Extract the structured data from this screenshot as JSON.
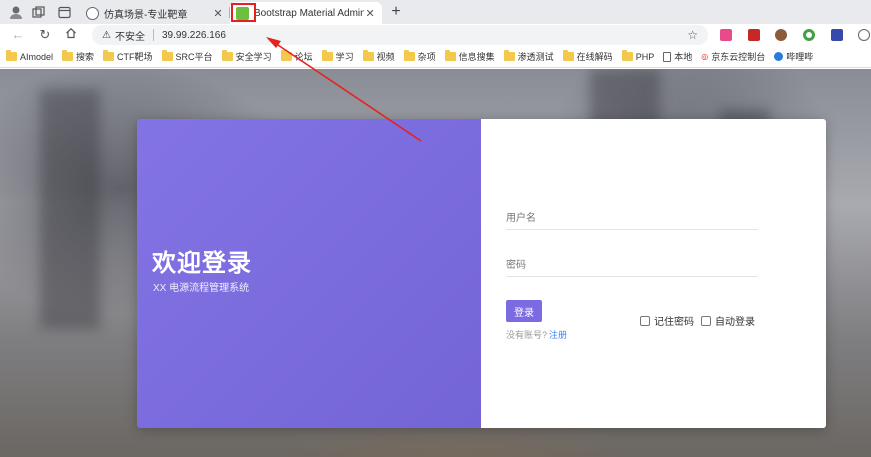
{
  "browser": {
    "tabs": [
      {
        "title": "仿真场景-专业靶章",
        "active": false,
        "favicon_color": "#555555"
      },
      {
        "title": "Bootstrap Material Admin",
        "active": true,
        "favicon_color": "#6cbf3f"
      }
    ],
    "new_tab_icon": "plus-icon",
    "address": {
      "security_label": "不安全",
      "url": "39.99.226.166"
    },
    "bookmarks": [
      {
        "label": "AImodel",
        "icon": "folder-icon"
      },
      {
        "label": "搜索",
        "icon": "folder-icon"
      },
      {
        "label": "CTF靶场",
        "icon": "folder-icon"
      },
      {
        "label": "SRC平台",
        "icon": "folder-icon"
      },
      {
        "label": "安全学习",
        "icon": "folder-icon"
      },
      {
        "label": "论坛",
        "icon": "folder-icon"
      },
      {
        "label": "学习",
        "icon": "folder-icon"
      },
      {
        "label": "视频",
        "icon": "folder-icon"
      },
      {
        "label": "杂项",
        "icon": "folder-icon"
      },
      {
        "label": "信息搜集",
        "icon": "folder-icon"
      },
      {
        "label": "渗透测试",
        "icon": "folder-icon"
      },
      {
        "label": "在线解码",
        "icon": "folder-icon"
      },
      {
        "label": "PHP",
        "icon": "folder-icon"
      },
      {
        "label": "本地",
        "icon": "page-icon"
      },
      {
        "label": "京东云控制台",
        "icon": "jd-icon"
      },
      {
        "label": "哔哩哔",
        "icon": "bilibili-icon"
      }
    ]
  },
  "login": {
    "welcome_title": "欢迎登录",
    "subtitle": "XX 电源流程管理系统",
    "username_placeholder": "用户名",
    "password_placeholder": "密码",
    "login_button": "登录",
    "remember_password": "记住密码",
    "auto_login": "自动登录",
    "no_account_text": "没有账号?",
    "register_link": "注册"
  },
  "colors": {
    "accent": "#7b6be3",
    "annotation": "#e8201f",
    "link": "#3b82f6"
  }
}
